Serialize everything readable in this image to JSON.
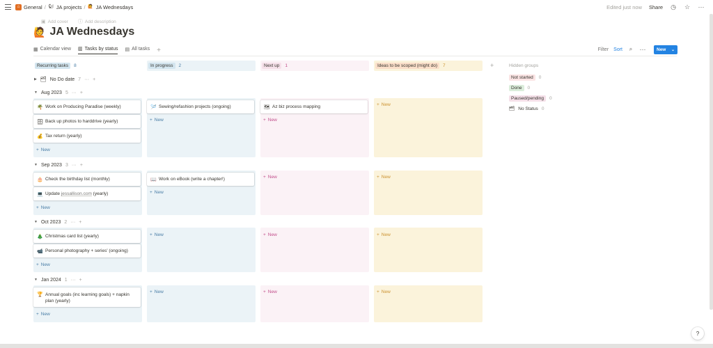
{
  "breadcrumbs": [
    {
      "label": "General",
      "icon": "house-icon"
    },
    {
      "label": "JA projects",
      "icon": "squirrel-icon"
    },
    {
      "label": "JA Wednesdays",
      "icon": "worker-icon"
    }
  ],
  "topbar": {
    "edited": "Edited just now",
    "share": "Share"
  },
  "header": {
    "add_cover": "Add cover",
    "add_description": "Add description",
    "title": "JA Wednesdays",
    "title_icon": "🙋"
  },
  "tabs": [
    {
      "label": "Calendar view",
      "icon": "calendar-icon"
    },
    {
      "label": "Tasks by status",
      "icon": "board-icon"
    },
    {
      "label": "All tasks",
      "icon": "table-icon"
    }
  ],
  "actions": {
    "filter": "Filter",
    "sort": "Sort",
    "more": "···",
    "new": "New",
    "new_caret": "⌄"
  },
  "columns": [
    {
      "label": "Recurring tasks",
      "count": "8",
      "pill_color": "#d3e5ef",
      "bg": "#ebf3f7",
      "text_color": "#487ca5"
    },
    {
      "label": "In progress",
      "count": "2",
      "pill_color": "#d3e5ef",
      "bg": "#ebf3f7",
      "text_color": "#487ca5"
    },
    {
      "label": "Next up",
      "count": "1",
      "pill_color": "#f5e0e9",
      "bg": "#fbf2f6",
      "text_color": "#c14c8a"
    },
    {
      "label": "Ideas to be scoped (might do)",
      "count": "7",
      "pill_color": "#fadec9",
      "bg": "#fbf3db",
      "text_color": "#cb912f"
    }
  ],
  "no_date": {
    "label": "No Do date",
    "count": "7"
  },
  "groups": [
    {
      "label": "Aug 2023",
      "count": "5"
    },
    {
      "label": "Sep 2023",
      "count": "3"
    },
    {
      "label": "Oct 2023",
      "count": "2"
    },
    {
      "label": "Jan 2024",
      "count": "1"
    }
  ],
  "cards": {
    "aug_rec": [
      {
        "icon": "🌴",
        "text": "Work on Producing Paradise (weekly)"
      },
      {
        "icon": "🗄",
        "text": "Back up photos to harddrive (yearly)"
      },
      {
        "icon": "💰",
        "text": "Tax return (yearly)"
      }
    ],
    "aug_prog": [
      {
        "icon": "🪡",
        "text": "Sewing/refashion projects (ongoing)"
      }
    ],
    "aug_next": [
      {
        "icon": "🗺",
        "text": "Az biz process mapping"
      }
    ],
    "sep_rec": [
      {
        "icon": "🎂",
        "text": "Check the birthday list (monthly)"
      },
      {
        "icon": "💻",
        "text_before": "Update ",
        "link": "jessallison.com",
        "text_after": " (yearly)"
      }
    ],
    "sep_prog": [
      {
        "icon": "📖",
        "text": "Work on eBook (write a chapter!)"
      }
    ],
    "oct_rec": [
      {
        "icon": "🎄",
        "text": "Christmas card list (yearly)"
      },
      {
        "icon": "📹",
        "text": "Personal photography + series' (ongoing)"
      }
    ],
    "jan_rec": [
      {
        "icon": "🏆",
        "text": "Annual goals (inc learning goals) + napkin plan (yearly)"
      }
    ]
  },
  "new_label": "New",
  "hidden": {
    "title": "Hidden groups",
    "items": [
      {
        "label": "Not started",
        "count": "0",
        "color": "#fbe4e4"
      },
      {
        "label": "Done",
        "count": "0",
        "color": "#dbeddb"
      },
      {
        "label": "Paused/pending",
        "count": "0",
        "color": "#f5e0e9"
      },
      {
        "label": "No Status",
        "count": "0",
        "color": ""
      }
    ]
  },
  "help": "?"
}
